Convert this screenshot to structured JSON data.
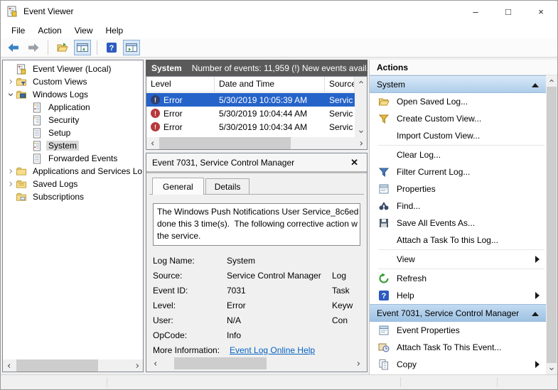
{
  "window": {
    "title": "Event Viewer",
    "controls": {
      "minimize": "–",
      "maximize": "□",
      "close": "×"
    }
  },
  "menu": {
    "file": "File",
    "action": "Action",
    "view": "View",
    "help": "Help"
  },
  "toolbar": {
    "icons": [
      "back-icon",
      "forward-icon",
      "open-saved-log-icon",
      "show-console-tree-icon",
      "help-icon",
      "show-action-pane-icon"
    ]
  },
  "tree": {
    "items": [
      {
        "label": "Event Viewer (Local)",
        "icon": "event-viewer-icon",
        "expand": "none",
        "selected": false
      },
      {
        "label": "Custom Views",
        "icon": "folder-filter-icon",
        "expand": "collapsed",
        "selected": false
      },
      {
        "label": "Windows Logs",
        "icon": "folder-logs-icon",
        "expand": "expanded",
        "selected": false
      },
      {
        "label": "Application",
        "icon": "event-log-icon",
        "expand": "none",
        "selected": false
      },
      {
        "label": "Security",
        "icon": "event-log-icon",
        "expand": "none",
        "selected": false
      },
      {
        "label": "Setup",
        "icon": "event-log-plain-icon",
        "expand": "none",
        "selected": false
      },
      {
        "label": "System",
        "icon": "event-log-icon",
        "expand": "none",
        "selected": true
      },
      {
        "label": "Forwarded Events",
        "icon": "event-log-plain-icon",
        "expand": "none",
        "selected": false
      },
      {
        "label": "Applications and Services Lo",
        "icon": "folder-icon",
        "expand": "collapsed",
        "selected": false
      },
      {
        "label": "Saved Logs",
        "icon": "folder-icon",
        "expand": "collapsed",
        "selected": false
      },
      {
        "label": "Subscriptions",
        "icon": "folder-icon",
        "expand": "none",
        "selected": false
      }
    ]
  },
  "log_header": {
    "name": "System",
    "info": "Number of events: 11,959 (!) New events avail..."
  },
  "event_list": {
    "columns": {
      "level": "Level",
      "date": "Date and Time",
      "source": "Source"
    },
    "rows": [
      {
        "level": "Error",
        "icon": "error-icon",
        "date": "5/30/2019 10:05:39 AM",
        "source": "Servic",
        "selected": true
      },
      {
        "level": "Error",
        "icon": "error-icon",
        "date": "5/30/2019 10:04:44 AM",
        "source": "Servic",
        "selected": false
      },
      {
        "level": "Error",
        "icon": "error-icon",
        "date": "5/30/2019 10:04:34 AM",
        "source": "Servic",
        "selected": false
      }
    ]
  },
  "event_details": {
    "title": "Event 7031, Service Control Manager",
    "tabs": {
      "general": "General",
      "details": "Details"
    },
    "description_lines": [
      "The Windows Push Notifications User Service_8c6ed s",
      "done this 3 time(s).  The following corrective action w",
      "the service."
    ],
    "fields": [
      {
        "label": "Log Name:",
        "value": "System",
        "right": ""
      },
      {
        "label": "Source:",
        "value": "Service Control Manager",
        "right": "Log"
      },
      {
        "label": "Event ID:",
        "value": "7031",
        "right": "Task"
      },
      {
        "label": "Level:",
        "value": "Error",
        "right": "Keyw"
      },
      {
        "label": "User:",
        "value": "N/A",
        "right": "Con"
      },
      {
        "label": "OpCode:",
        "value": "Info",
        "right": ""
      },
      {
        "label": "More Information:",
        "value": "Event Log Online Help",
        "right": ""
      }
    ]
  },
  "actions": {
    "title": "Actions",
    "sections": [
      {
        "header": "System",
        "items": [
          {
            "label": "Open Saved Log...",
            "icon": "open-folder-icon"
          },
          {
            "label": "Create Custom View...",
            "icon": "funnel-yellow-icon"
          },
          {
            "label": "Import Custom View...",
            "icon": "none"
          },
          {
            "label": "Clear Log...",
            "icon": "none"
          },
          {
            "label": "Filter Current Log...",
            "icon": "funnel-blue-icon"
          },
          {
            "label": "Properties",
            "icon": "properties-icon"
          },
          {
            "label": "Find...",
            "icon": "binoculars-icon"
          },
          {
            "label": "Save All Events As...",
            "icon": "save-icon"
          },
          {
            "label": "Attach a Task To this Log...",
            "icon": "none"
          },
          {
            "label": "View",
            "icon": "none",
            "submenu": true
          },
          {
            "label": "Refresh",
            "icon": "refresh-icon"
          },
          {
            "label": "Help",
            "icon": "help-icon",
            "submenu": true
          }
        ]
      },
      {
        "header": "Event 7031, Service Control Manager",
        "items": [
          {
            "label": "Event Properties",
            "icon": "properties-icon"
          },
          {
            "label": "Attach Task To This Event...",
            "icon": "task-clock-icon"
          },
          {
            "label": "Copy",
            "icon": "copy-icon",
            "submenu": true
          }
        ]
      }
    ]
  },
  "colors": {
    "selection_blue": "#2563c9",
    "error_red": "#b6393c",
    "link_blue": "#0563c1",
    "log_header_gray": "#5a5a5a",
    "section_header_blue": "#aecde9"
  }
}
